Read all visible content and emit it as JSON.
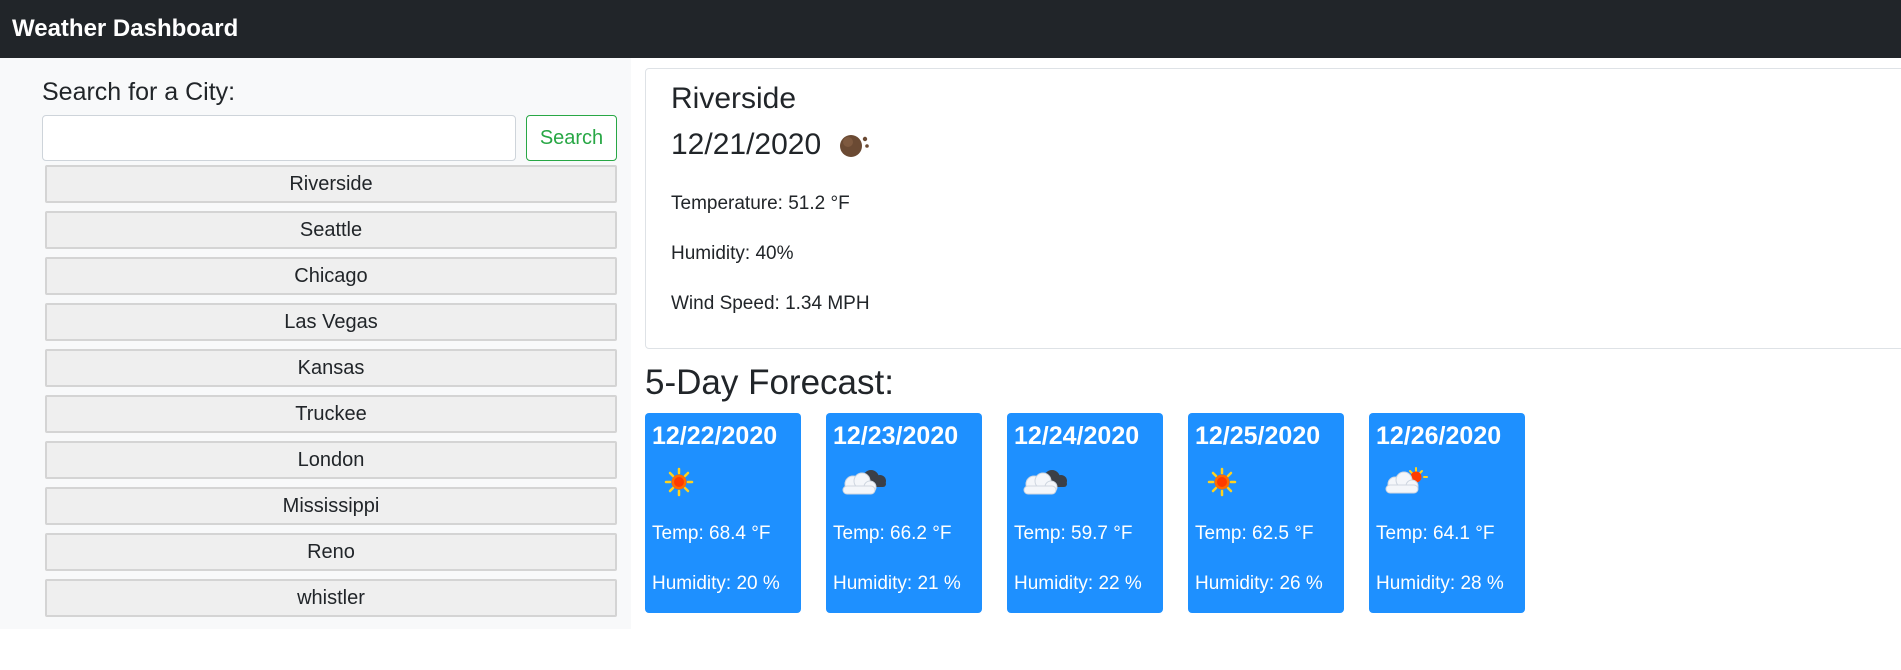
{
  "navbar": {
    "title": "Weather Dashboard"
  },
  "search": {
    "heading": "Search for a City:",
    "placeholder": "",
    "button_label": "Search"
  },
  "history": [
    "Riverside",
    "Seattle",
    "Chicago",
    "Las Vegas",
    "Kansas",
    "Truckee",
    "London",
    "Mississippi",
    "Reno",
    "whistler"
  ],
  "current": {
    "city": "Riverside",
    "date": "12/21/2020",
    "icon": "moon-icon",
    "temperature": "Temperature: 51.2 °F",
    "humidity": "Humidity: 40%",
    "wind": "Wind Speed: 1.34 MPH"
  },
  "forecast": {
    "title": "5-Day Forecast:",
    "days": [
      {
        "date": "12/22/2020",
        "icon": "sun-icon",
        "temp": "Temp: 68.4 °F",
        "humidity": "Humidity: 20 %"
      },
      {
        "date": "12/23/2020",
        "icon": "clouds-icon",
        "temp": "Temp: 66.2 °F",
        "humidity": "Humidity: 21 %"
      },
      {
        "date": "12/24/2020",
        "icon": "clouds-icon",
        "temp": "Temp: 59.7 °F",
        "humidity": "Humidity: 22 %"
      },
      {
        "date": "12/25/2020",
        "icon": "sun-icon",
        "temp": "Temp: 62.5 °F",
        "humidity": "Humidity: 26 %"
      },
      {
        "date": "12/26/2020",
        "icon": "partly-cloudy-icon",
        "temp": "Temp: 64.1 °F",
        "humidity": "Humidity: 28 %"
      }
    ]
  },
  "colors": {
    "navbar": "#212529",
    "sidebar": "#f8f9fa",
    "search_button": "#28a745",
    "forecast_card": "#1e90ff"
  }
}
